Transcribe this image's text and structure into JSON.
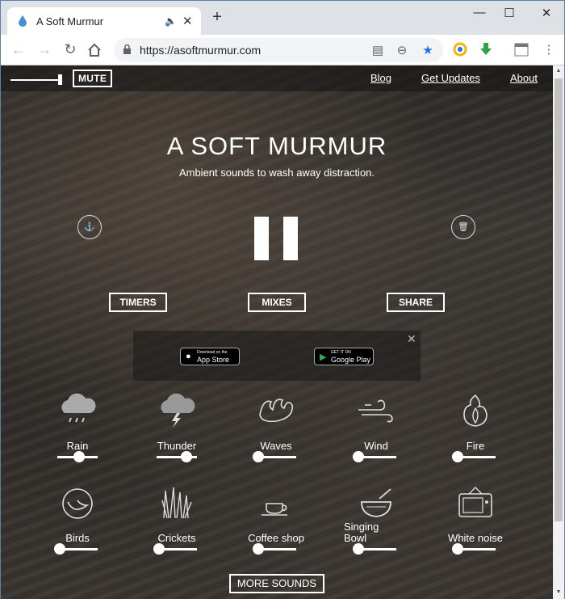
{
  "browser": {
    "tab_title": "A Soft Murmur",
    "new_tab": "+",
    "url": "https://asoftmurmur.com",
    "controls": {
      "minimize": "—",
      "maximize": "☐",
      "close": "✕"
    }
  },
  "header": {
    "mute": "MUTE",
    "volume_level": 1.0,
    "nav": [
      "Blog",
      "Get Updates",
      "About"
    ]
  },
  "hero": {
    "title": "A SOFT MURMUR",
    "subtitle": "Ambient sounds to wash away distraction."
  },
  "buttons": {
    "timers": "TIMERS",
    "mixes": "MIXES",
    "share": "SHARE",
    "more": "MORE SOUNDS"
  },
  "promo": {
    "appstore_small": "Download on the",
    "appstore": "App Store",
    "play_small": "GET IT ON",
    "play": "Google Play",
    "close": "✕"
  },
  "sounds": [
    {
      "label": "Rain",
      "level": 0.6,
      "icon": "rain-cloud-icon"
    },
    {
      "label": "Thunder",
      "level": 0.85,
      "icon": "thunder-cloud-icon"
    },
    {
      "label": "Waves",
      "level": 0.0,
      "icon": "waves-icon"
    },
    {
      "label": "Wind",
      "level": 0.0,
      "icon": "wind-icon"
    },
    {
      "label": "Fire",
      "level": 0.0,
      "icon": "fire-icon"
    },
    {
      "label": "Birds",
      "level": 0.0,
      "icon": "bird-icon"
    },
    {
      "label": "Crickets",
      "level": 0.0,
      "icon": "grass-icon"
    },
    {
      "label": "Coffee shop",
      "level": 0.0,
      "icon": "coffee-cup-icon"
    },
    {
      "label": "Singing Bowl",
      "level": 0.0,
      "icon": "singing-bowl-icon"
    },
    {
      "label": "White noise",
      "level": 0.0,
      "icon": "tv-icon"
    }
  ]
}
